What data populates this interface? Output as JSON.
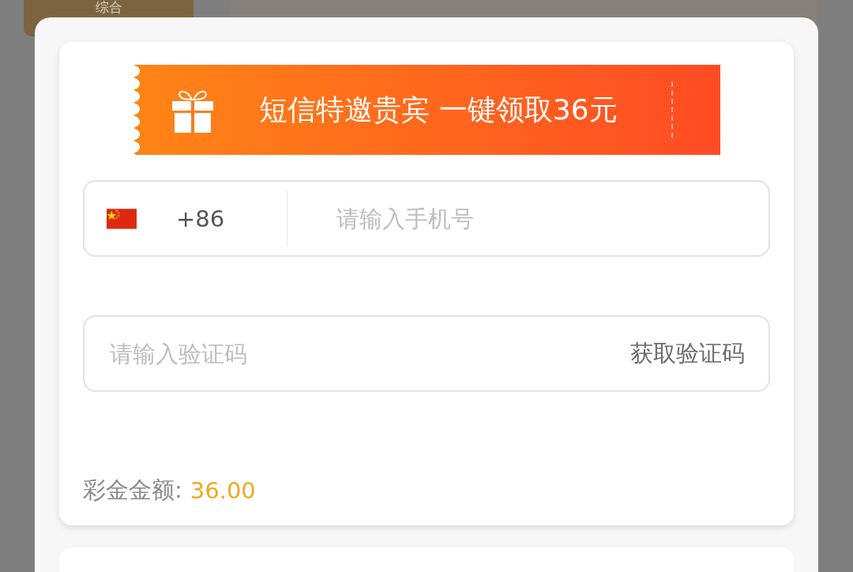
{
  "background_tab": {
    "label": "综合"
  },
  "banner": {
    "title": "短信特邀贵宾 一键领取36元"
  },
  "phone_field": {
    "country_code": "+86",
    "placeholder": "请输入手机号"
  },
  "code_field": {
    "placeholder": "请输入验证码",
    "action": "获取验证码"
  },
  "bonus": {
    "label": "彩金金额:",
    "amount": "36.00"
  }
}
